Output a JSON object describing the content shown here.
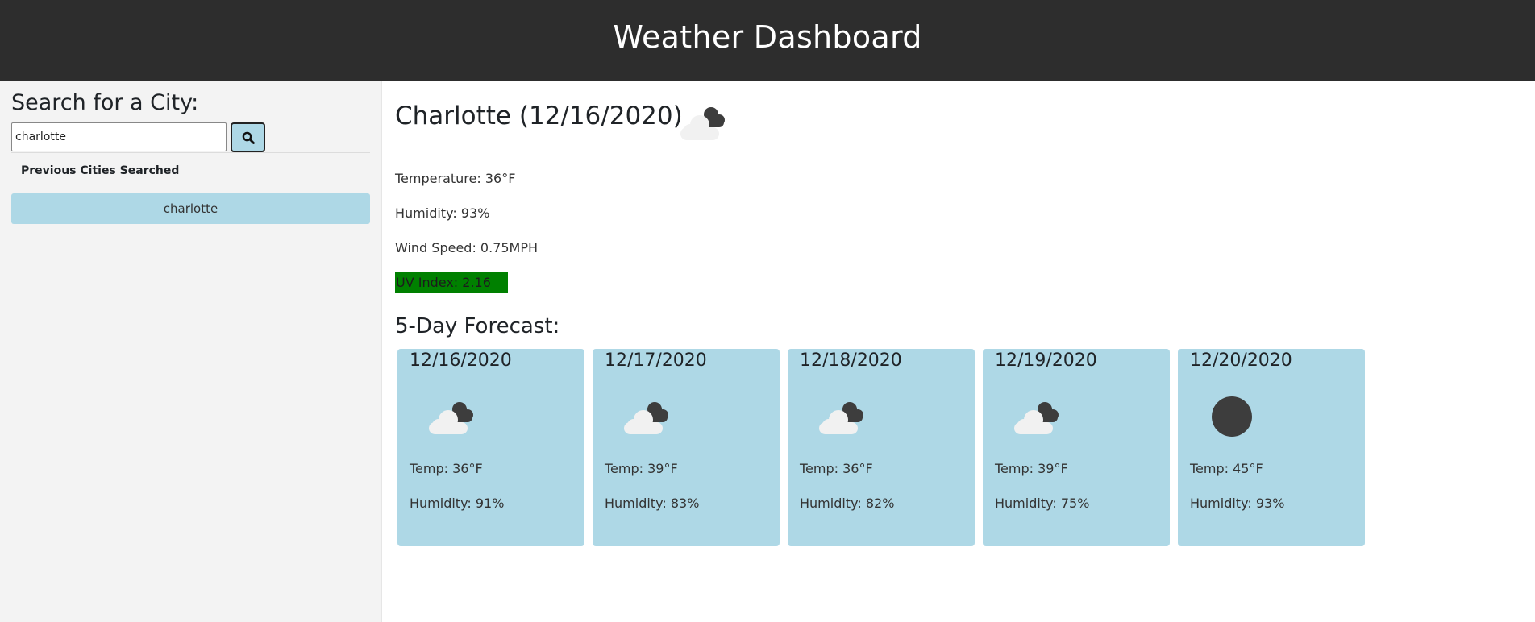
{
  "header": {
    "title": "Weather Dashboard"
  },
  "sidebar": {
    "heading": "Search for a City:",
    "search": {
      "value": "charlotte",
      "button_icon": "search-icon"
    },
    "history_title": "Previous Cities Searched",
    "history": [
      "charlotte"
    ]
  },
  "current": {
    "title": "Charlotte (12/16/2020)",
    "icon": "cloud-icon",
    "temperature": "Temperature: 36°F",
    "humidity": "Humidity: 93%",
    "wind": "Wind Speed: 0.75MPH",
    "uv": "UV Index: 2.16",
    "uv_color": "#008000"
  },
  "forecast": {
    "title": "5-Day Forecast:",
    "days": [
      {
        "date": "12/16/2020",
        "icon": "cloud-icon",
        "temp": "Temp: 36°F",
        "humidity": "Humidity: 91%"
      },
      {
        "date": "12/17/2020",
        "icon": "cloud-icon",
        "temp": "Temp: 39°F",
        "humidity": "Humidity: 83%"
      },
      {
        "date": "12/18/2020",
        "icon": "cloud-icon",
        "temp": "Temp: 36°F",
        "humidity": "Humidity: 82%"
      },
      {
        "date": "12/19/2020",
        "icon": "cloud-icon",
        "temp": "Temp: 39°F",
        "humidity": "Humidity: 75%"
      },
      {
        "date": "12/20/2020",
        "icon": "clear-icon",
        "temp": "Temp: 45°F",
        "humidity": "Humidity: 93%"
      }
    ]
  },
  "colors": {
    "header_bg": "#2d2d2d",
    "card_bg": "#aed8e6",
    "sidebar_bg": "#f3f3f3"
  }
}
